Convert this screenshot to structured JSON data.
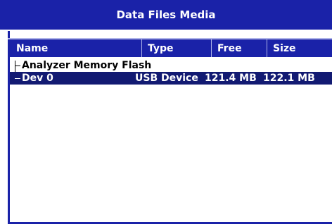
{
  "window": {
    "title": "Data Files Media"
  },
  "table": {
    "columns": [
      "Name",
      "Type",
      "Free",
      "Size"
    ],
    "items": [
      {
        "name": "Analyzer Memory Flash",
        "type": "",
        "free": "",
        "size": "",
        "selected": false
      },
      {
        "name": "Dev 0",
        "type": "USB Device",
        "free": "121.4 MB",
        "size": "122.1 MB",
        "selected": true
      }
    ]
  },
  "colors": {
    "titlebar": "#1a22a8",
    "selection": "#121a72",
    "background": "#ffffff"
  }
}
